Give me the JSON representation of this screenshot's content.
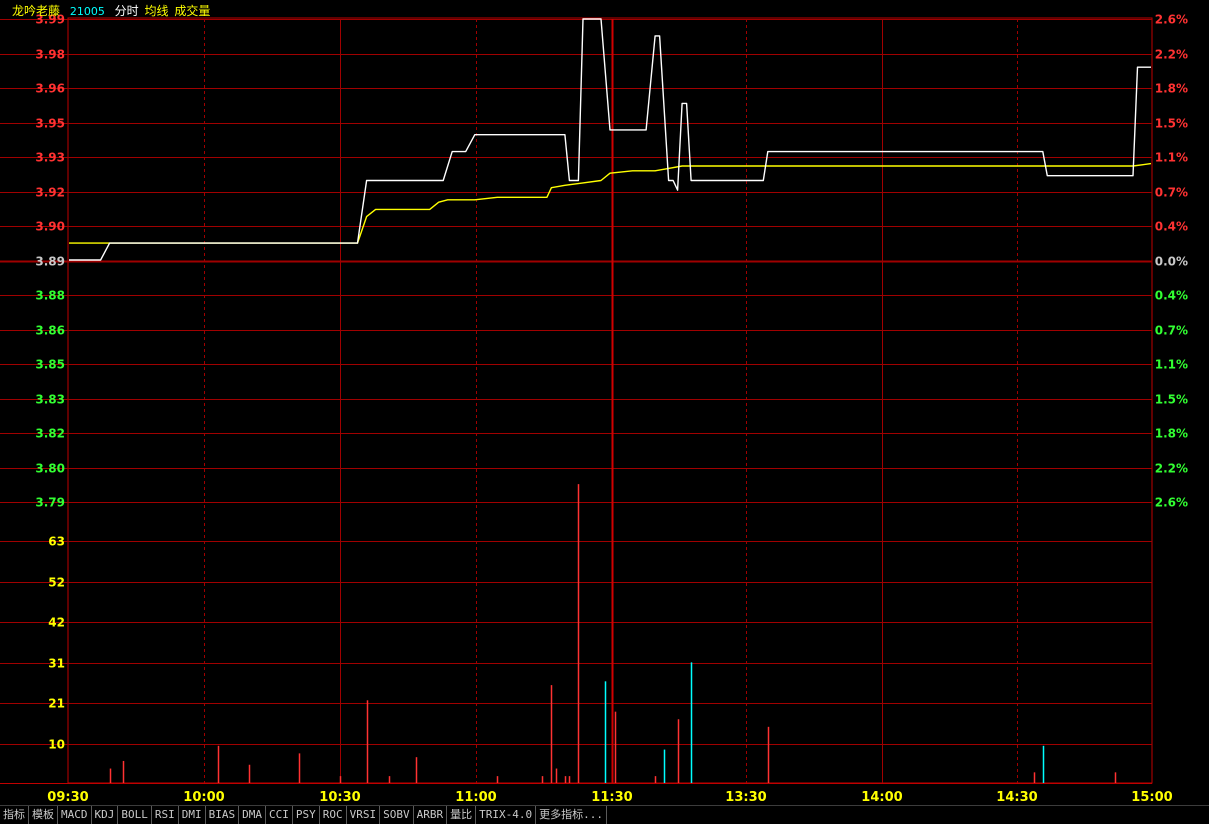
{
  "header": {
    "stock_name": "龙吟老藤",
    "stock_code": "21005",
    "label_timeshare": "分时",
    "label_avg": "均线",
    "label_volume": "成交量"
  },
  "tabs": [
    "指标",
    "模板",
    "MACD",
    "KDJ",
    "BOLL",
    "RSI",
    "DMI",
    "BIAS",
    "DMA",
    "CCI",
    "PSY",
    "ROC",
    "VRSI",
    "SOBV",
    "ARBR",
    "量比",
    "TRIX-4.0",
    "更多指标..."
  ],
  "colors": {
    "grid": "#a00000",
    "axis": "#c00000",
    "price_line": "#ffffff",
    "avg_line": "#ffff00",
    "up_label": "#ff3232",
    "down_label": "#32ff32",
    "neutral_label": "#c8c8c8",
    "volume_up": "#ff3232",
    "volume_down": "#00ffff",
    "volume_label": "#ffff00",
    "time_label": "#ffff00"
  },
  "chart_data": {
    "type": "line",
    "prev_close": 3.89,
    "price_ticks": [
      "3.99",
      "3.98",
      "3.96",
      "3.95",
      "3.93",
      "3.92",
      "3.90",
      "3.89",
      "3.88",
      "3.86",
      "3.85",
      "3.83",
      "3.82",
      "3.80",
      "3.79"
    ],
    "pct_ticks": [
      "2.6%",
      "2.2%",
      "1.8%",
      "1.5%",
      "1.1%",
      "0.7%",
      "0.4%",
      "0.0%",
      "0.4%",
      "0.7%",
      "1.1%",
      "1.5%",
      "1.8%",
      "2.2%",
      "2.6%"
    ],
    "volume_ticks": [
      "63",
      "52",
      "42",
      "31",
      "21",
      "10"
    ],
    "time_ticks": [
      "09:30",
      "10:00",
      "10:30",
      "11:00",
      "11:30",
      "13:30",
      "14:00",
      "14:30",
      "15:00"
    ],
    "price_series": [
      [
        0,
        3.89
      ],
      [
        7,
        3.89
      ],
      [
        9,
        3.897
      ],
      [
        64,
        3.897
      ],
      [
        66,
        3.923
      ],
      [
        68,
        3.923
      ],
      [
        83,
        3.923
      ],
      [
        85,
        3.935
      ],
      [
        88,
        3.935
      ],
      [
        90,
        3.942
      ],
      [
        110,
        3.942
      ],
      [
        111,
        3.923
      ],
      [
        113,
        3.923
      ],
      [
        114,
        3.99
      ],
      [
        118,
        3.99
      ],
      [
        120,
        3.944
      ],
      [
        128,
        3.944
      ],
      [
        130,
        3.983
      ],
      [
        131,
        3.983
      ],
      [
        133,
        3.923
      ],
      [
        134,
        3.923
      ],
      [
        135,
        3.919
      ],
      [
        136,
        3.955
      ],
      [
        137,
        3.955
      ],
      [
        138,
        3.923
      ],
      [
        154,
        3.923
      ],
      [
        155,
        3.935
      ],
      [
        216,
        3.935
      ],
      [
        217,
        3.925
      ],
      [
        236,
        3.925
      ],
      [
        237,
        3.97
      ],
      [
        240,
        3.97
      ]
    ],
    "avg_series": [
      [
        0,
        3.897
      ],
      [
        64,
        3.897
      ],
      [
        66,
        3.908
      ],
      [
        68,
        3.911
      ],
      [
        70,
        3.911
      ],
      [
        75,
        3.911
      ],
      [
        80,
        3.911
      ],
      [
        82,
        3.914
      ],
      [
        84,
        3.915
      ],
      [
        90,
        3.915
      ],
      [
        95,
        3.916
      ],
      [
        100,
        3.916
      ],
      [
        106,
        3.916
      ],
      [
        107,
        3.92
      ],
      [
        110,
        3.921
      ],
      [
        114,
        3.922
      ],
      [
        118,
        3.923
      ],
      [
        120,
        3.926
      ],
      [
        125,
        3.927
      ],
      [
        130,
        3.927
      ],
      [
        133,
        3.928
      ],
      [
        136,
        3.929
      ],
      [
        138,
        3.929
      ],
      [
        150,
        3.929
      ],
      [
        160,
        3.929
      ],
      [
        200,
        3.929
      ],
      [
        236,
        3.929
      ],
      [
        240,
        3.93
      ]
    ],
    "volume": [
      {
        "t": 9,
        "v": 3,
        "dir": "up"
      },
      {
        "t": 12,
        "v": 5,
        "dir": "up"
      },
      {
        "t": 33,
        "v": 9,
        "dir": "up"
      },
      {
        "t": 40,
        "v": 4,
        "dir": "up"
      },
      {
        "t": 51,
        "v": 7,
        "dir": "up"
      },
      {
        "t": 60,
        "v": 1,
        "dir": "up"
      },
      {
        "t": 66,
        "v": 21,
        "dir": "up"
      },
      {
        "t": 71,
        "v": 1,
        "dir": "up"
      },
      {
        "t": 77,
        "v": 6,
        "dir": "up"
      },
      {
        "t": 95,
        "v": 1,
        "dir": "up"
      },
      {
        "t": 105,
        "v": 1,
        "dir": "up"
      },
      {
        "t": 107,
        "v": 25,
        "dir": "up"
      },
      {
        "t": 108,
        "v": 3,
        "dir": "up"
      },
      {
        "t": 110,
        "v": 1,
        "dir": "up"
      },
      {
        "t": 111,
        "v": 1,
        "dir": "up"
      },
      {
        "t": 113,
        "v": 78,
        "dir": "up"
      },
      {
        "t": 119,
        "v": 26,
        "dir": "down"
      },
      {
        "t": 121,
        "v": 18,
        "dir": "up"
      },
      {
        "t": 130,
        "v": 1,
        "dir": "up"
      },
      {
        "t": 132,
        "v": 8,
        "dir": "down"
      },
      {
        "t": 135,
        "v": 16,
        "dir": "up"
      },
      {
        "t": 138,
        "v": 31,
        "dir": "down"
      },
      {
        "t": 155,
        "v": 14,
        "dir": "up"
      },
      {
        "t": 214,
        "v": 2,
        "dir": "up"
      },
      {
        "t": 216,
        "v": 9,
        "dir": "down"
      },
      {
        "t": 232,
        "v": 2,
        "dir": "up"
      }
    ]
  }
}
